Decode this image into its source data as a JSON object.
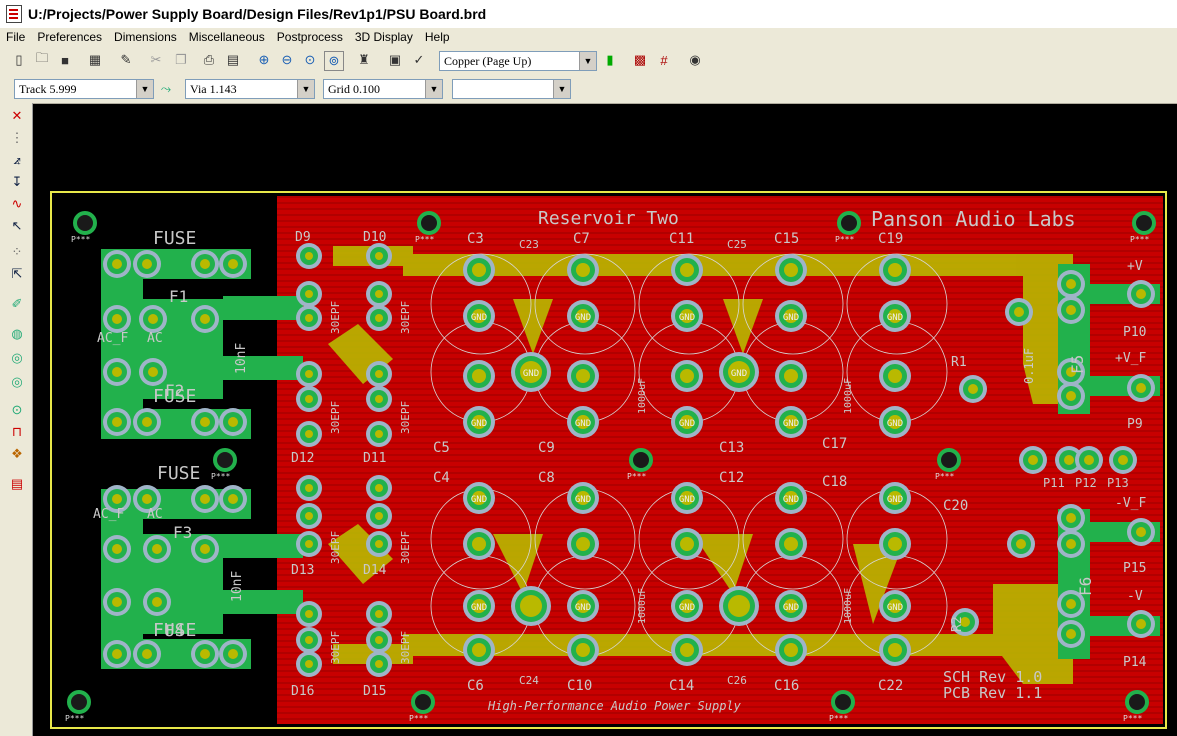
{
  "window": {
    "title": "U:/Projects/Power Supply Board/Design Files/Rev1p1/PSU Board.brd"
  },
  "menu": [
    "File",
    "Preferences",
    "Dimensions",
    "Miscellaneous",
    "Postprocess",
    "3D Display",
    "Help"
  ],
  "toolbar": {
    "layer_combo": "Copper (Page Up)",
    "icons": [
      "new-icon",
      "open-icon",
      "save-icon",
      "board-icon",
      "edit-icon",
      "cut-icon",
      "copy-icon",
      "paste-icon",
      "print-icon",
      "print-preview-icon",
      "zoom-in-icon",
      "zoom-out-icon",
      "zoom-fit-icon",
      "zoom-window-icon",
      "find-icon",
      "tools-icon",
      "layer-color-icon",
      "drc-icon",
      "net-icon",
      "library-icon"
    ]
  },
  "toolbar2": {
    "track": "Track 5.999",
    "via": "Via 1.143",
    "grid": "Grid 0.100",
    "extra": ""
  },
  "left_tools": [
    "delete-icon",
    "grid-dots-icon",
    "route-icon",
    "measure-icon",
    "inductor-icon",
    "select-icon",
    "pad-dots-icon",
    "move-icon",
    "edit-pencil-icon",
    "layer-icon",
    "swap-icon",
    "swap2-icon",
    "net-circle-icon",
    "track-icon",
    "component-icon",
    "drc-report-icon"
  ],
  "pcb": {
    "board_title": "Reservoir Two",
    "brand": "Panson Audio Labs",
    "subtitle": "High-Performance Audio Power Supply",
    "sch_rev": "SCH Rev 1.0",
    "pcb_rev": "PCB Rev 1.1",
    "fuse_labels": [
      "FUSE",
      "FUSE",
      "FUSE",
      "FUSE"
    ],
    "fuses": [
      "F1",
      "F2",
      "F3",
      "F4",
      "F5",
      "F6"
    ],
    "ac_labels": [
      "AC_F",
      "AC",
      "AC_F",
      "AC"
    ],
    "diodes": [
      "D9",
      "D10",
      "D12",
      "D11",
      "D13",
      "D14",
      "D16",
      "D15"
    ],
    "diode_part": "30EPF",
    "caps_top": [
      "C3",
      "C7",
      "C11",
      "C15",
      "C19"
    ],
    "caps_mid": [
      "C5",
      "C9",
      "C13",
      "C17"
    ],
    "caps_mid2": [
      "C4",
      "C8",
      "C12",
      "C18"
    ],
    "caps_bot": [
      "C6",
      "C10",
      "C14",
      "C16",
      "C22"
    ],
    "small_caps": [
      "C23",
      "C25",
      "C24",
      "C26",
      "C20"
    ],
    "resistors": [
      "R1",
      "R2"
    ],
    "ports": [
      "+V",
      "P10",
      "+V_F",
      "P9",
      "-V_F",
      "P15",
      "-V",
      "P14",
      "P11",
      "P12",
      "P13"
    ],
    "pad_gnd": "GND",
    "pad_pwr": "P***",
    "cap_value": "1000uF",
    "cap_film": "10nF",
    "cap_small": "0.1uF"
  }
}
